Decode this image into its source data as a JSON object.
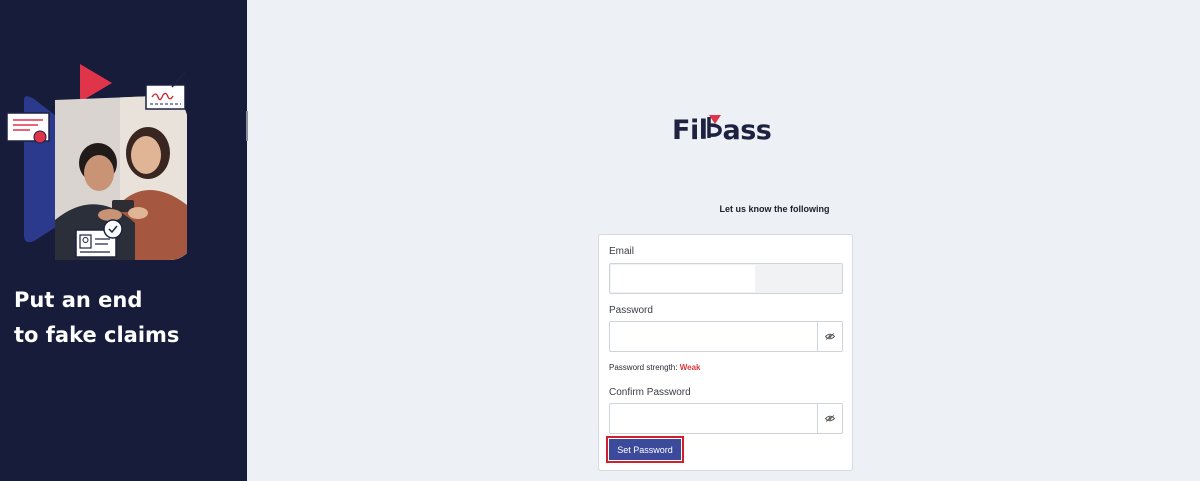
{
  "sidebar": {
    "tagline_line1": "Put an end",
    "tagline_line2": "to fake claims",
    "illustration": "couple-viewing-phone-with-certificates"
  },
  "brand": {
    "name_prefix": "Fil",
    "name_suffix": "ass",
    "accent_color": "#e0344b",
    "primary_color": "#3b4a9a"
  },
  "form": {
    "subtitle": "Let us know the following",
    "email_label": "Email",
    "email_value": "",
    "password_label": "Password",
    "password_value": "",
    "strength_label": "Password strength:",
    "strength_value": "Weak",
    "confirm_label": "Confirm Password",
    "confirm_value": "",
    "submit_label": "Set Password",
    "eye_icon": "eye-icon"
  }
}
